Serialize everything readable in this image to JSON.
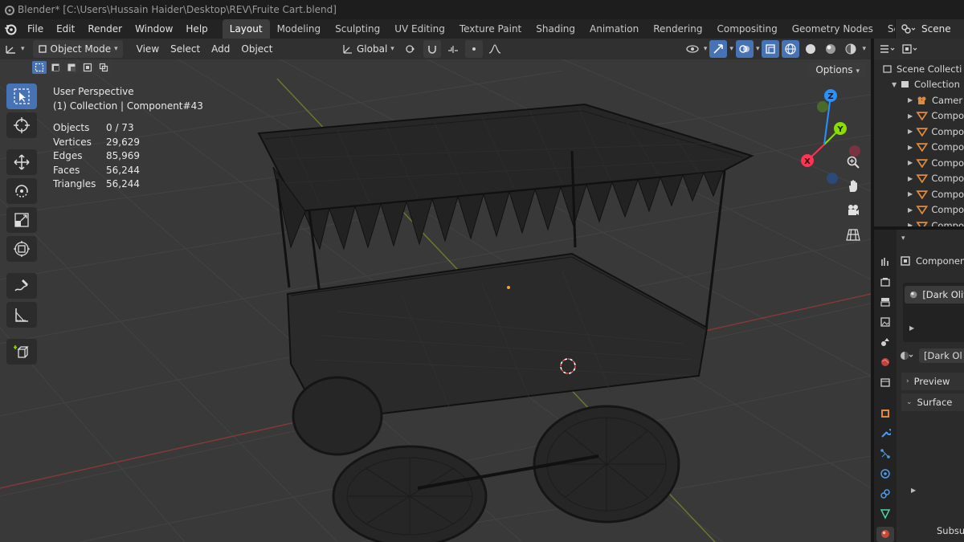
{
  "title": "Blender* [C:\\Users\\Hussain Haider\\Desktop\\REV\\Fruite Cart.blend]",
  "menu": [
    "File",
    "Edit",
    "Render",
    "Window",
    "Help"
  ],
  "workspaces": [
    "Layout",
    "Modeling",
    "Sculpting",
    "UV Editing",
    "Texture Paint",
    "Shading",
    "Animation",
    "Rendering",
    "Compositing",
    "Geometry Nodes",
    "Scripting"
  ],
  "active_workspace": "Layout",
  "scene": "Scene",
  "viewport": {
    "mode": "Object Mode",
    "menus": [
      "View",
      "Select",
      "Add",
      "Object"
    ],
    "transform_orientation": "Global",
    "options_label": "Options",
    "perspective": "User Perspective",
    "collection_info": "(1) Collection | Component#43",
    "stats": [
      {
        "label": "Objects",
        "value": "0 / 73"
      },
      {
        "label": "Vertices",
        "value": "29,629"
      },
      {
        "label": "Edges",
        "value": "85,969"
      },
      {
        "label": "Faces",
        "value": "56,244"
      },
      {
        "label": "Triangles",
        "value": "56,244"
      }
    ],
    "gizmo": {
      "x": "X",
      "y": "Y",
      "z": "Z"
    }
  },
  "outliner": {
    "items": [
      {
        "label": "Scene Collecti",
        "indent": 0
      },
      {
        "label": "Collection",
        "indent": 1
      },
      {
        "label": "Camer",
        "indent": 2
      },
      {
        "label": "Compo",
        "indent": 2
      },
      {
        "label": "Compo",
        "indent": 2
      },
      {
        "label": "Compo",
        "indent": 2
      },
      {
        "label": "Compo",
        "indent": 2
      },
      {
        "label": "Compo",
        "indent": 2
      },
      {
        "label": "Compo",
        "indent": 2
      },
      {
        "label": "Compo",
        "indent": 2
      },
      {
        "label": "Compo",
        "indent": 2
      }
    ]
  },
  "properties": {
    "object_name": "Componen",
    "material_slot": "[Dark Oliv",
    "material_name": "[Dark Ol",
    "preview": "Preview",
    "surface": "Surface",
    "subsurface": "Subsu"
  },
  "colors": {
    "accent": "#4772b3",
    "axis_x": "#ff3352",
    "axis_y": "#8bdc00",
    "axis_z": "#2890ff",
    "viewport_bg": "#393939"
  }
}
